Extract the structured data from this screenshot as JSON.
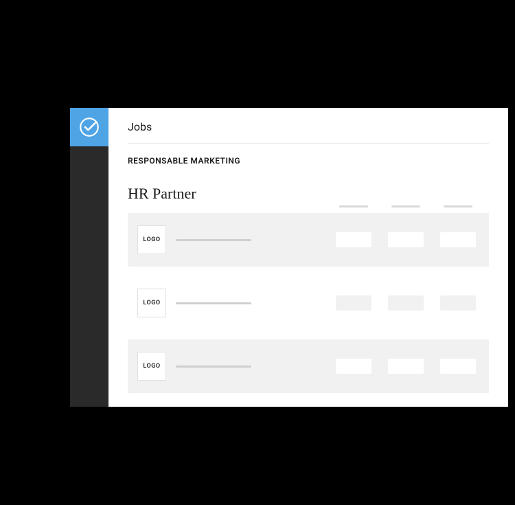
{
  "header": {
    "title": "Jobs"
  },
  "breadcrumb": "RESPONSABLE MARKETING",
  "section": {
    "title": "HR Partner"
  },
  "rows": [
    {
      "logo_label": "LOGO"
    },
    {
      "logo_label": "LOGO"
    },
    {
      "logo_label": "LOGO"
    }
  ]
}
